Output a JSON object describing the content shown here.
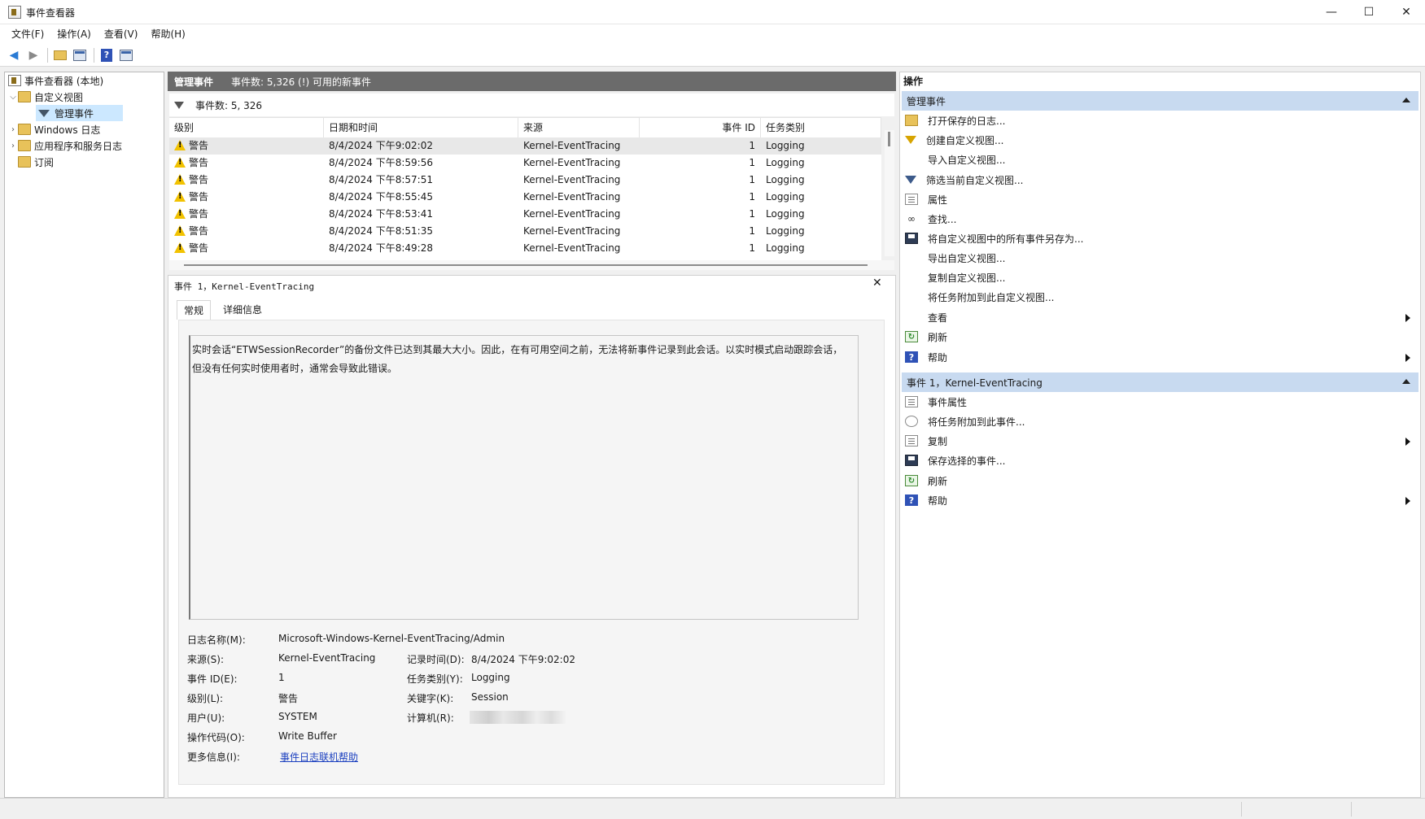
{
  "window": {
    "title": "事件查看器",
    "controls": {
      "minimize": "—",
      "maximize": "☐",
      "close": "✕"
    }
  },
  "menu": [
    "文件(F)",
    "操作(A)",
    "查看(V)",
    "帮助(H)"
  ],
  "tree": {
    "root": "事件查看器 (本地)",
    "custom_views": "自定义视图",
    "admin_events": "管理事件",
    "windows_logs": "Windows 日志",
    "app_service_logs": "应用程序和服务日志",
    "subscriptions": "订阅"
  },
  "center": {
    "header_title": "管理事件",
    "header_info": "事件数: 5,326 (!) 可用的新事件",
    "filter_text": "事件数: 5, 326",
    "columns": [
      "级别",
      "日期和时间",
      "来源",
      "事件 ID",
      "任务类别"
    ],
    "rows": [
      {
        "level": "警告",
        "datetime": "8/4/2024 下午9:02:02",
        "source": "Kernel-EventTracing",
        "event_id": "1",
        "category": "Logging"
      },
      {
        "level": "警告",
        "datetime": "8/4/2024 下午8:59:56",
        "source": "Kernel-EventTracing",
        "event_id": "1",
        "category": "Logging"
      },
      {
        "level": "警告",
        "datetime": "8/4/2024 下午8:57:51",
        "source": "Kernel-EventTracing",
        "event_id": "1",
        "category": "Logging"
      },
      {
        "level": "警告",
        "datetime": "8/4/2024 下午8:55:45",
        "source": "Kernel-EventTracing",
        "event_id": "1",
        "category": "Logging"
      },
      {
        "level": "警告",
        "datetime": "8/4/2024 下午8:53:41",
        "source": "Kernel-EventTracing",
        "event_id": "1",
        "category": "Logging"
      },
      {
        "level": "警告",
        "datetime": "8/4/2024 下午8:51:35",
        "source": "Kernel-EventTracing",
        "event_id": "1",
        "category": "Logging"
      },
      {
        "level": "警告",
        "datetime": "8/4/2024 下午8:49:28",
        "source": "Kernel-EventTracing",
        "event_id": "1",
        "category": "Logging"
      }
    ]
  },
  "detail": {
    "title": "事件 1，Kernel-EventTracing",
    "close": "✕",
    "tabs": [
      "常规",
      "详细信息"
    ],
    "description_line1": "实时会话“ETWSessionRecorder”的备份文件已达到其最大大小。因此，在有可用空间之前，无法将新事件记录到此会话。以实时模式启动跟踪会话，",
    "description_line2": "但没有任何实时使用者时，通常会导致此错误。",
    "fields": {
      "log_name_label": "日志名称(M):",
      "log_name": "Microsoft-Windows-Kernel-EventTracing/Admin",
      "source_label": "来源(S):",
      "source": "Kernel-EventTracing",
      "logged_label": "记录时间(D):",
      "logged": "8/4/2024 下午9:02:02",
      "event_id_label": "事件 ID(E):",
      "event_id": "1",
      "task_label": "任务类别(Y):",
      "task": "Logging",
      "level_label": "级别(L):",
      "level": "警告",
      "keywords_label": "关键字(K):",
      "keywords": "Session",
      "user_label": "用户(U):",
      "user": "SYSTEM",
      "computer_label": "计算机(R):",
      "opcode_label": "操作代码(O):",
      "opcode": "Write Buffer",
      "more_info_label": "更多信息(I):",
      "more_info_link": "事件日志联机帮助"
    }
  },
  "actions": {
    "title": "操作",
    "section1": {
      "title": "管理事件",
      "items": [
        "打开保存的日志...",
        "创建自定义视图...",
        "导入自定义视图...",
        "筛选当前自定义视图...",
        "属性",
        "查找...",
        "将自定义视图中的所有事件另存为...",
        "导出自定义视图...",
        "复制自定义视图...",
        "将任务附加到此自定义视图...",
        "查看",
        "刷新",
        "帮助"
      ]
    },
    "section2": {
      "title": "事件 1，Kernel-EventTracing",
      "items": [
        "事件属性",
        "将任务附加到此事件...",
        "复制",
        "保存选择的事件...",
        "刷新",
        "帮助"
      ]
    }
  },
  "colors": {
    "header_bg": "#6b6b6b",
    "section_bg": "#c8daf0",
    "selection": "#cce8ff",
    "warning": "#f2c200",
    "link": "#1a3fbf"
  }
}
